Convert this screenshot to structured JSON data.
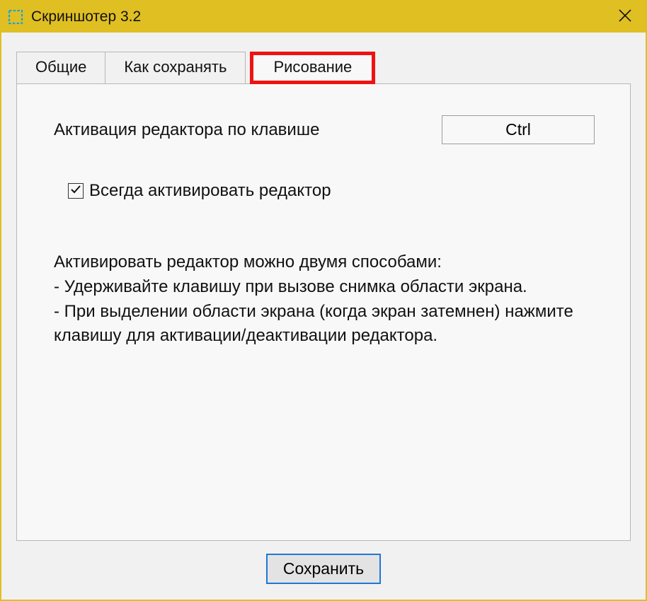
{
  "window": {
    "title": "Скриншотер 3.2"
  },
  "tabs": {
    "general": "Общие",
    "how_to_save": "Как сохранять",
    "drawing": "Рисование"
  },
  "content": {
    "activation_label": "Активация редактора по клавише",
    "activation_key": "Ctrl",
    "always_activate_label": "Всегда активировать редактор",
    "always_activate_checked": true,
    "help_text": "Активировать редактор можно двумя способами:\n- Удерживайте клавишу при вызове снимка области экрана.\n- При выделении области экрана (когда экран затемнен) нажмите клавишу для активации/деактивации редактора."
  },
  "footer": {
    "save_label": "Сохранить"
  }
}
